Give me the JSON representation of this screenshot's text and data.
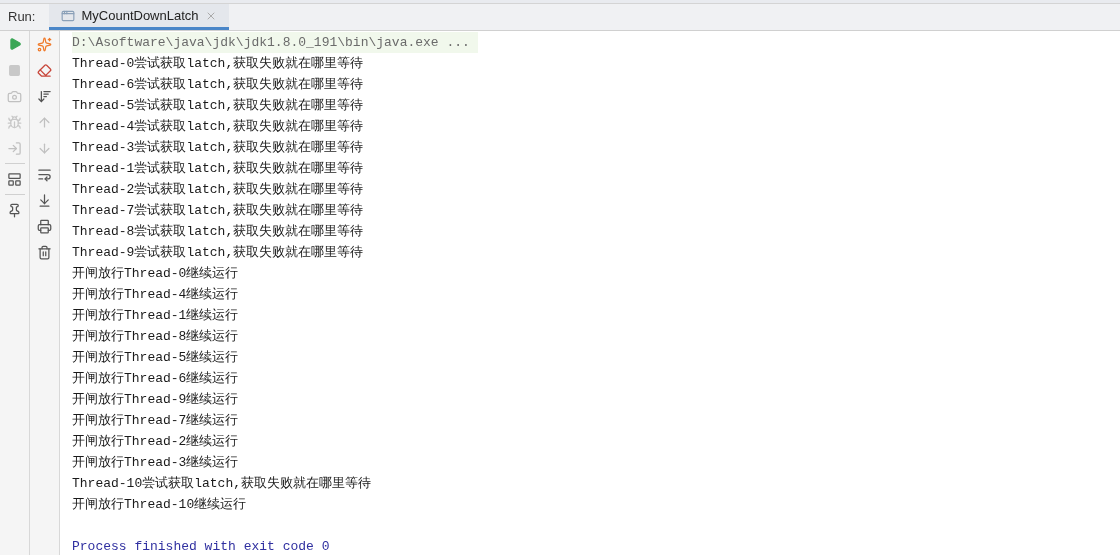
{
  "run_panel": {
    "label": "Run:",
    "tabs": [
      {
        "label": "MyCountDownLatch",
        "selected": true,
        "closable": true
      }
    ]
  },
  "console": {
    "lines": [
      {
        "kind": "command",
        "text": "D:\\Asoftware\\java\\jdk\\jdk1.8.0_191\\bin\\java.exe ..."
      },
      {
        "kind": "output",
        "text": "Thread-0尝试获取latch,获取失败就在哪里等待"
      },
      {
        "kind": "output",
        "text": "Thread-6尝试获取latch,获取失败就在哪里等待"
      },
      {
        "kind": "output",
        "text": "Thread-5尝试获取latch,获取失败就在哪里等待"
      },
      {
        "kind": "output",
        "text": "Thread-4尝试获取latch,获取失败就在哪里等待"
      },
      {
        "kind": "output",
        "text": "Thread-3尝试获取latch,获取失败就在哪里等待"
      },
      {
        "kind": "output",
        "text": "Thread-1尝试获取latch,获取失败就在哪里等待"
      },
      {
        "kind": "output",
        "text": "Thread-2尝试获取latch,获取失败就在哪里等待"
      },
      {
        "kind": "output",
        "text": "Thread-7尝试获取latch,获取失败就在哪里等待"
      },
      {
        "kind": "output",
        "text": "Thread-8尝试获取latch,获取失败就在哪里等待"
      },
      {
        "kind": "output",
        "text": "Thread-9尝试获取latch,获取失败就在哪里等待"
      },
      {
        "kind": "output",
        "text": "开闸放行Thread-0继续运行"
      },
      {
        "kind": "output",
        "text": "开闸放行Thread-4继续运行"
      },
      {
        "kind": "output",
        "text": "开闸放行Thread-1继续运行"
      },
      {
        "kind": "output",
        "text": "开闸放行Thread-8继续运行"
      },
      {
        "kind": "output",
        "text": "开闸放行Thread-5继续运行"
      },
      {
        "kind": "output",
        "text": "开闸放行Thread-6继续运行"
      },
      {
        "kind": "output",
        "text": "开闸放行Thread-9继续运行"
      },
      {
        "kind": "output",
        "text": "开闸放行Thread-7继续运行"
      },
      {
        "kind": "output",
        "text": "开闸放行Thread-2继续运行"
      },
      {
        "kind": "output",
        "text": "开闸放行Thread-3继续运行"
      },
      {
        "kind": "output",
        "text": "Thread-10尝试获取latch,获取失败就在哪里等待"
      },
      {
        "kind": "output",
        "text": "开闸放行Thread-10继续运行"
      },
      {
        "kind": "blank"
      },
      {
        "kind": "exit",
        "text": "Process finished with exit code 0"
      }
    ]
  }
}
